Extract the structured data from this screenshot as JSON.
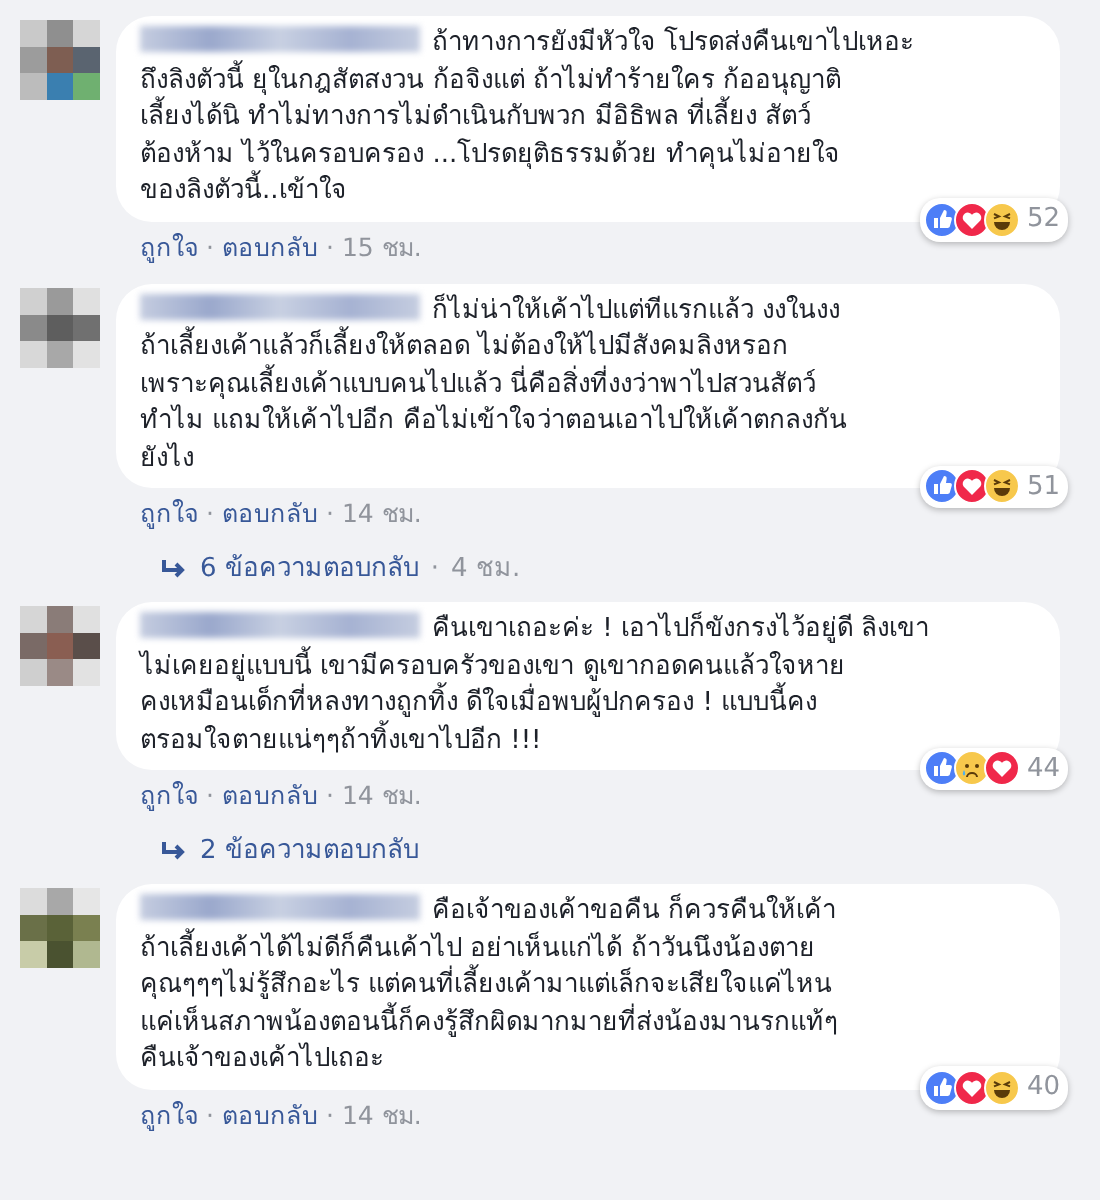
{
  "comments": [
    {
      "text": "ถ้าทางการยังมีหัวใจ โปรดส่งคืนเขาไปเหอะ\nถึงลิงตัวนี้ ยุในกฎสัตสงวน ก้อจิงแต่ ถ้าไม่ทำร้ายใคร ก้ออนุญาติ\nเลี้ยงได้นิ ทำไม่ทางการไม่ดำเนินกับพวก มีอิธิพล ที่เลี้ยง สัตว์\nต้องห้าม ไว้ในครอบครอง ...โปรดยุติธรรมด้วย ทำคุนไม่อายใจ\nของลิงตัวนี้..เข้าใจ",
      "reactions": {
        "icons": [
          {
            "kind": "like"
          },
          {
            "kind": "love"
          },
          {
            "kind": "haha"
          }
        ],
        "count": "52"
      },
      "meta": [
        {
          "kind": "link",
          "text": "ถูกใจ"
        },
        {
          "kind": "dot",
          "text": "·"
        },
        {
          "kind": "link",
          "text": "ตอบกลับ"
        },
        {
          "kind": "dot",
          "text": "·"
        },
        {
          "kind": "time",
          "text": "15 ชม."
        }
      ]
    },
    {
      "text": "ก็ไม่น่าให้เค้าไปแต่ทีแรกแล้ว งงในงง\nถ้าเลี้ยงเค้าแล้วก็เลี้ยงให้ตลอด ไม่ต้องให้ไปมีสังคมลิงหรอก\nเพราะคุณเลี้ยงเค้าแบบคนไปแล้ว นี่คือสิ่งที่งงว่าพาไปสวนสัตว์\nทำไม แถมให้เค้าไปอีก คือไม่เข้าใจว่าตอนเอาไปให้เค้าตกลงกัน\nยังไง",
      "reactions": {
        "icons": [
          {
            "kind": "like"
          },
          {
            "kind": "love"
          },
          {
            "kind": "haha"
          }
        ],
        "count": "51"
      },
      "meta": [
        {
          "kind": "link",
          "text": "ถูกใจ"
        },
        {
          "kind": "dot",
          "text": "·"
        },
        {
          "kind": "link",
          "text": "ตอบกลับ"
        },
        {
          "kind": "dot",
          "text": "·"
        },
        {
          "kind": "time",
          "text": "14 ชม."
        }
      ],
      "replies": [
        {
          "kind": "link",
          "text": "6 ข้อความตอบกลับ"
        },
        {
          "kind": "dot",
          "text": "·"
        },
        {
          "kind": "time",
          "text": "4 ชม."
        }
      ]
    },
    {
      "text": "คืนเขาเถอะค่ะ ! เอาไปก็ขังกรงไว้อยู่ดี ลิงเขา\nไม่เคยอยู่แบบนี้ เขามีครอบครัวของเขา ดูเขากอดคนแล้วใจหาย\nคงเหมือนเด็กที่หลงทางถูกทิ้ง ดีใจเมื่อพบผู้ปกครอง ! แบบนี้คง\nตรอมใจตายแน่ๆๆถ้าทิ้งเขาไปอีก !!!",
      "reactions": {
        "icons": [
          {
            "kind": "like"
          },
          {
            "kind": "sad"
          },
          {
            "kind": "love"
          }
        ],
        "count": "44"
      },
      "meta": [
        {
          "kind": "link",
          "text": "ถูกใจ"
        },
        {
          "kind": "dot",
          "text": "·"
        },
        {
          "kind": "link",
          "text": "ตอบกลับ"
        },
        {
          "kind": "dot",
          "text": "·"
        },
        {
          "kind": "time",
          "text": "14 ชม."
        }
      ],
      "replies": [
        {
          "kind": "link",
          "text": "2 ข้อความตอบกลับ"
        }
      ]
    },
    {
      "text": "คือเจ้าของเค้าขอคืน ก็ควรคืนให้เค้า\nถ้าเลี้ยงเค้าได้ไม่ดีก็คืนเค้าไป อย่าเห็นแก่ได้ ถ้าวันนึงน้องตาย\nคุณๆๆๆไม่รู้สึกอะไร แต่คนที่เลี้ยงเค้ามาแต่เล็กจะเสียใจแค่ไหน\nแค่เห็นสภาพน้องตอนนี้ก็คงรู้สึกผิดมากมายที่ส่งน้องมานรกแท้ๆ\nคืนเจ้าของเค้าไปเถอะ",
      "reactions": {
        "icons": [
          {
            "kind": "like"
          },
          {
            "kind": "love"
          },
          {
            "kind": "haha"
          }
        ],
        "count": "40"
      },
      "meta": [
        {
          "kind": "link",
          "text": "ถูกใจ"
        },
        {
          "kind": "dot",
          "text": "·"
        },
        {
          "kind": "link",
          "text": "ตอบกลับ"
        },
        {
          "kind": "dot",
          "text": "·"
        },
        {
          "kind": "time",
          "text": "14 ชม."
        }
      ]
    }
  ]
}
